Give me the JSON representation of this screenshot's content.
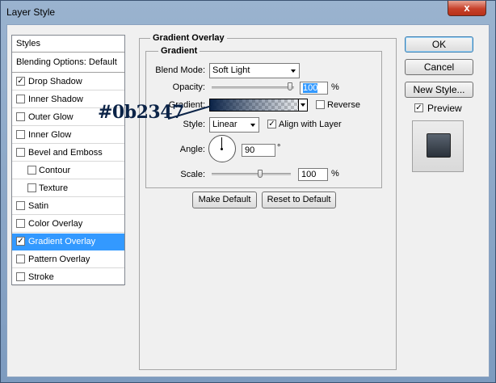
{
  "window": {
    "title": "Layer Style",
    "close_label": "x"
  },
  "styles_list": {
    "header": "Styles",
    "blending": "Blending Options: Default",
    "items": [
      {
        "label": "Drop Shadow",
        "checked": true
      },
      {
        "label": "Inner Shadow",
        "checked": false
      },
      {
        "label": "Outer Glow",
        "checked": false
      },
      {
        "label": "Inner Glow",
        "checked": false
      },
      {
        "label": "Bevel and Emboss",
        "checked": false
      },
      {
        "label": "Contour",
        "checked": false
      },
      {
        "label": "Texture",
        "checked": false
      },
      {
        "label": "Satin",
        "checked": false
      },
      {
        "label": "Color Overlay",
        "checked": false
      },
      {
        "label": "Gradient Overlay",
        "checked": true
      },
      {
        "label": "Pattern Overlay",
        "checked": false
      },
      {
        "label": "Stroke",
        "checked": false
      }
    ],
    "check_mark": "✓"
  },
  "panel": {
    "title": "Gradient Overlay",
    "subtitle": "Gradient",
    "blend_mode_label": "Blend Mode:",
    "blend_mode_value": "Soft Light",
    "opacity_label": "Opacity:",
    "opacity_value": "100",
    "opacity_unit": "%",
    "gradient_label": "Gradient:",
    "reverse_label": "Reverse",
    "style_label": "Style:",
    "style_value": "Linear",
    "align_label": "Align with Layer",
    "angle_label": "Angle:",
    "angle_value": "90",
    "angle_unit": "°",
    "scale_label": "Scale:",
    "scale_value": "100",
    "scale_unit": "%",
    "make_default": "Make Default",
    "reset_default": "Reset to Default"
  },
  "gradient_color": "#0b2347",
  "annotation": "#0b2347",
  "right": {
    "ok": "OK",
    "cancel": "Cancel",
    "new_style": "New Style...",
    "preview_label": "Preview"
  }
}
